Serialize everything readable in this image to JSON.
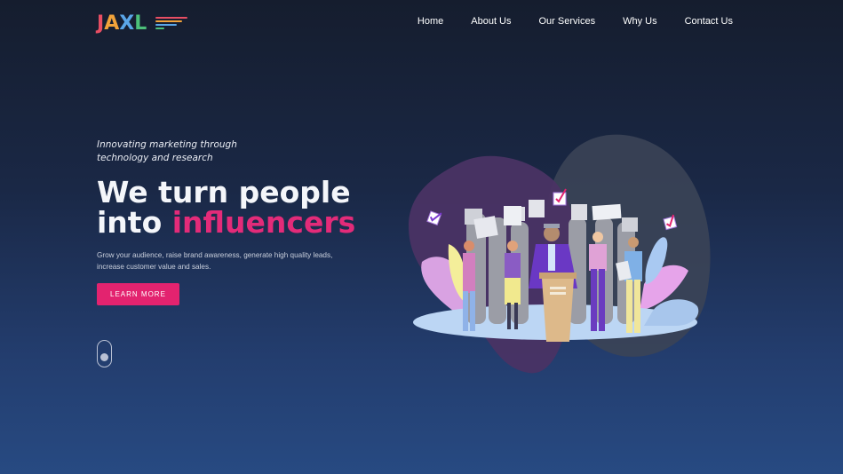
{
  "logo": {
    "letters": [
      "J",
      "A",
      "X",
      "L"
    ]
  },
  "nav": {
    "items": [
      "Home",
      "About Us",
      "Our Services",
      "Why Us",
      "Contact Us"
    ]
  },
  "hero": {
    "tagline": "Innovating marketing through technology and research",
    "headline_line1": "We turn people",
    "headline_prefix": "into ",
    "headline_accent": "influencers",
    "description": "Grow your audience, raise brand awareness, generate high quality leads, increase customer value and sales.",
    "cta_label": "LEARN MORE"
  },
  "colors": {
    "accent": "#e3236f",
    "background_top": "#151d2e",
    "background_bottom": "#274a82"
  },
  "icons": [
    "menu-lines-icon",
    "scroll-mouse-icon"
  ]
}
